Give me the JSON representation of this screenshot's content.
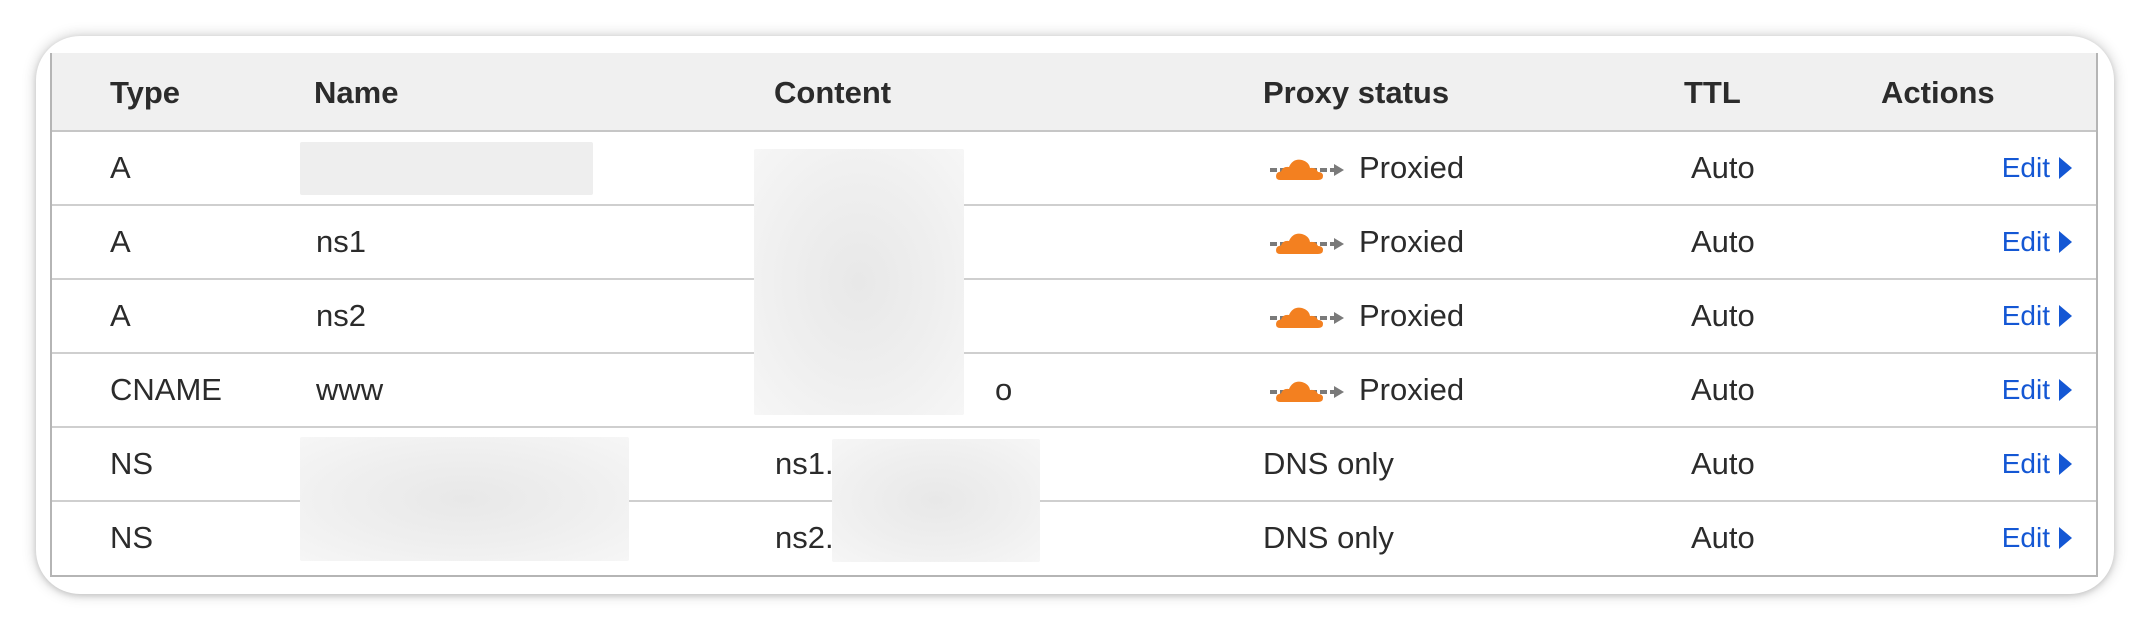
{
  "table": {
    "headers": {
      "type": "Type",
      "name": "Name",
      "content": "Content",
      "proxy_status": "Proxy status",
      "ttl": "TTL",
      "actions": "Actions"
    },
    "rows": [
      {
        "type": "A",
        "name": "",
        "content": "",
        "proxy_status": "Proxied",
        "proxy_icon": "cloud-proxied-icon",
        "ttl": "Auto",
        "action": "Edit"
      },
      {
        "type": "A",
        "name": "ns1",
        "content": "",
        "proxy_status": "Proxied",
        "proxy_icon": "cloud-proxied-icon",
        "ttl": "Auto",
        "action": "Edit"
      },
      {
        "type": "A",
        "name": "ns2",
        "content": "",
        "proxy_status": "Proxied",
        "proxy_icon": "cloud-proxied-icon",
        "ttl": "Auto",
        "action": "Edit"
      },
      {
        "type": "CNAME",
        "name": "www",
        "content": "o",
        "proxy_status": "Proxied",
        "proxy_icon": "cloud-proxied-icon",
        "ttl": "Auto",
        "action": "Edit"
      },
      {
        "type": "NS",
        "name": "",
        "content": "ns1.",
        "proxy_status": "DNS only",
        "ttl": "Auto",
        "action": "Edit"
      },
      {
        "type": "NS",
        "name": "",
        "content": "ns2.",
        "proxy_status": "DNS only",
        "ttl": "Auto",
        "action": "Edit"
      }
    ]
  },
  "colors": {
    "link": "#1457d4",
    "cloud_orange": "#f38020",
    "arrow_gray": "#7a7a7a",
    "header_bg": "#f0f0f0",
    "redaction": "#eeeeee"
  }
}
